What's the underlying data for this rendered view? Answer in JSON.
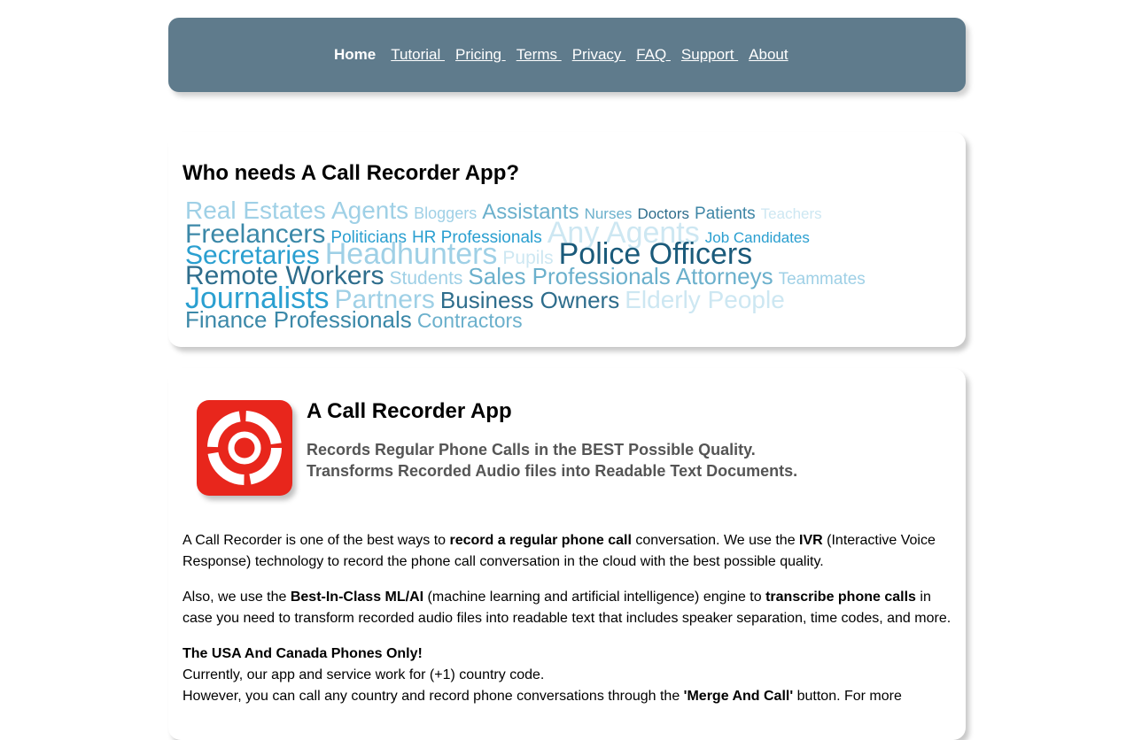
{
  "nav": {
    "items": [
      {
        "label": "Home",
        "active": true
      },
      {
        "label": "Tutorial ",
        "active": false
      },
      {
        "label": "Pricing ",
        "active": false
      },
      {
        "label": "Terms ",
        "active": false
      },
      {
        "label": "Privacy ",
        "active": false
      },
      {
        "label": "FAQ ",
        "active": false
      },
      {
        "label": "Support ",
        "active": false
      },
      {
        "label": "About",
        "active": false
      }
    ]
  },
  "who": {
    "title": "Who needs A Call Recorder App?",
    "lines": [
      [
        {
          "text": "Real Estates Agents",
          "size": 28,
          "color": "#9fd0e6"
        },
        {
          "text": "Bloggers",
          "size": 18,
          "color": "#9fd0e6"
        },
        {
          "text": "Assistants",
          "size": 24,
          "color": "#6bb0cc"
        },
        {
          "text": "Nurses",
          "size": 17,
          "color": "#6bb0cc"
        },
        {
          "text": "Doctors",
          "size": 17,
          "color": "#2e6d8c"
        },
        {
          "text": "Patients",
          "size": 19,
          "color": "#3f86a6"
        },
        {
          "text": "Teachers",
          "size": 17,
          "color": "#cde7f2"
        }
      ],
      [
        {
          "text": "Freelancers",
          "size": 30,
          "color": "#3b88a8"
        },
        {
          "text": "Politicians",
          "size": 19,
          "color": "#2a9fd0"
        },
        {
          "text": "HR Professionals",
          "size": 19,
          "color": "#2a9fd0"
        },
        {
          "text": "Any Agents",
          "size": 34,
          "color": "#cde7f2"
        },
        {
          "text": "Job Candidates",
          "size": 17,
          "color": "#2a9fd0"
        }
      ],
      [
        {
          "text": "Secretaries",
          "size": 30,
          "color": "#2a9fd0"
        },
        {
          "text": "Headhunters",
          "size": 34,
          "color": "#9fd0e6"
        },
        {
          "text": "Pupils",
          "size": 21,
          "color": "#cde7f2"
        },
        {
          "text": "Police Officers",
          "size": 34,
          "color": "#1a5a7a"
        }
      ],
      [
        {
          "text": "Remote Workers",
          "size": 30,
          "color": "#2e6d8c"
        },
        {
          "text": "Students",
          "size": 21,
          "color": "#9fd0e6"
        },
        {
          "text": "Sales Professionals",
          "size": 26,
          "color": "#6bb0cc"
        },
        {
          "text": "Attorneys",
          "size": 26,
          "color": "#6bb0cc"
        },
        {
          "text": "Teammates",
          "size": 19,
          "color": "#9fd0e6"
        }
      ],
      [
        {
          "text": "Journalists",
          "size": 34,
          "color": "#2a9fd0"
        },
        {
          "text": "Partners",
          "size": 30,
          "color": "#9fd0e6"
        },
        {
          "text": "Business Owners",
          "size": 26,
          "color": "#2e6d8c"
        },
        {
          "text": "Elderly People",
          "size": 28,
          "color": "#cde7f2"
        }
      ],
      [
        {
          "text": "Finance Professionals",
          "size": 26,
          "color": "#3b88a8"
        },
        {
          "text": "Contractors",
          "size": 23,
          "color": "#6bb0cc"
        }
      ]
    ]
  },
  "app": {
    "title": "A Call Recorder App",
    "tagline1": "Records Regular Phone Calls in the BEST Possible Quality.",
    "tagline2": "Transforms Recorded Audio files into Readable Text Documents.",
    "p1": {
      "t1": "A Call Recorder is one of the best ways to ",
      "b1": "record a regular phone call",
      "t2": " conversation. We use the ",
      "b2": "IVR",
      "t3": " (Interactive Voice Response) technology to record the phone call conversation in the cloud with the best possible quality."
    },
    "p2": {
      "t1": "Also, we use the ",
      "b1": "Best-In-Class ML/AI",
      "t2": " (machine learning and artificial intelligence) engine to ",
      "b2": "transcribe phone calls",
      "t3": " in case you need to transform recorded audio files into readable text that includes speaker separation, time codes, and more."
    },
    "p3": {
      "b1": "The USA And Canada Phones Only!",
      "l2": "Currently, our app and service work for (+1) country code.",
      "t3": "However, you can call any country and record phone conversations through the ",
      "b3": "'Merge And Call'",
      "t4": " button. For more"
    }
  }
}
